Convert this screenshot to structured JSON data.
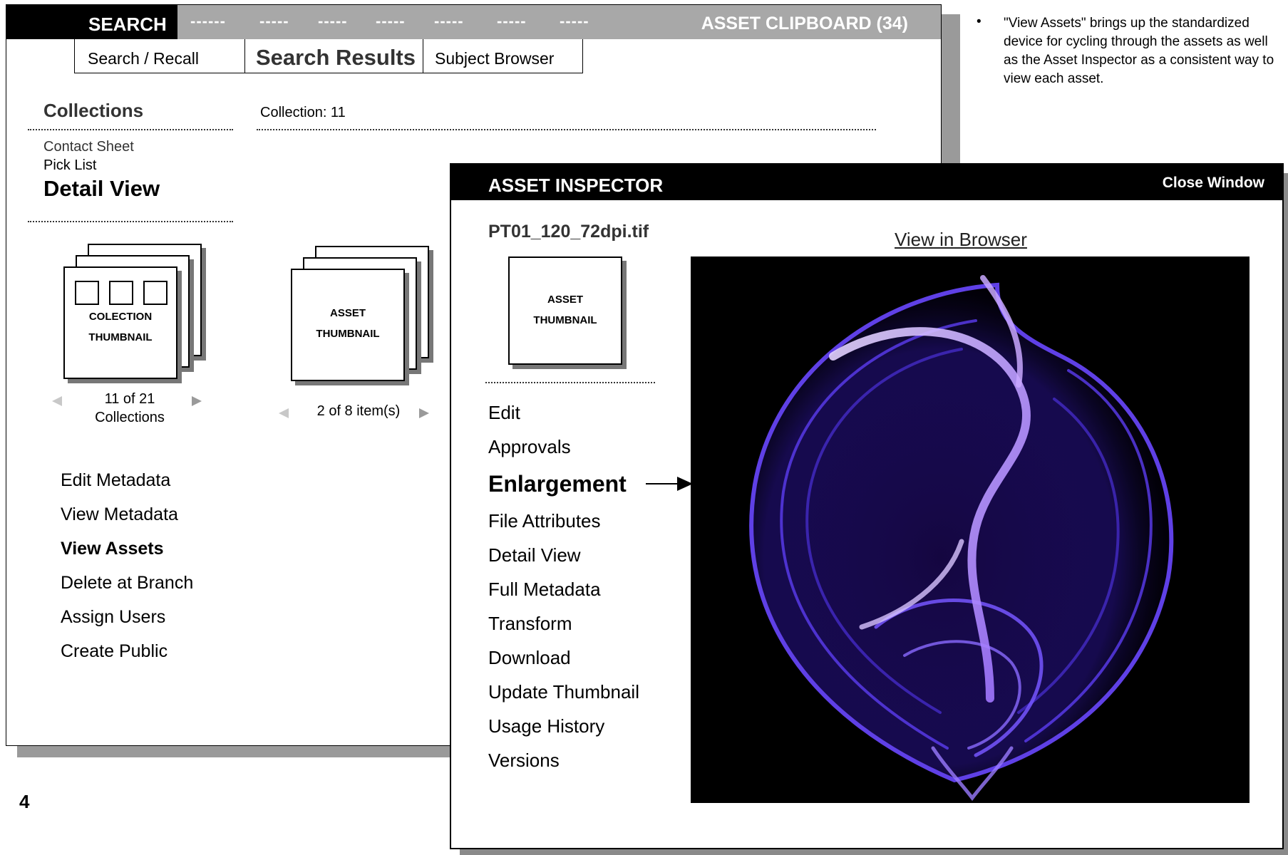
{
  "main": {
    "search_tab": "SEARCH",
    "dashes": [
      "------",
      "-----",
      "-----",
      "-----",
      "-----",
      "-----",
      "-----"
    ],
    "clipboard_label": "ASSET CLIPBOARD (34)",
    "tabs": [
      "Search / Recall",
      "Search Results",
      "Subject Browser"
    ],
    "collections_title": "Collections",
    "collection_label": "Collection: 11",
    "views": [
      "Contact Sheet",
      "Pick List",
      "Detail View"
    ],
    "collection_thumb": [
      "COLECTION",
      "THUMBNAIL"
    ],
    "asset_thumb": [
      "ASSET",
      "THUMBNAIL"
    ],
    "collection_pager": [
      "11 of  21",
      "Collections"
    ],
    "asset_pager": "2 of  8 item(s)",
    "actions": [
      "Edit Metadata",
      "View Metadata",
      "View Assets",
      "Delete at Branch",
      "Assign Users",
      "Create Public"
    ]
  },
  "page_number": "4",
  "note": "\"View Assets\" brings up the standardized device for cycling through the assets as well as the Asset Inspector as a consistent way to view each asset.",
  "inspector": {
    "title": "ASSET INSPECTOR",
    "close_label": "Close Window",
    "file_name": "PT01_120_72dpi.tif",
    "view_in_browser": "View in  Browser",
    "thumb": [
      "ASSET",
      "THUMBNAIL"
    ],
    "menu": [
      "Edit",
      "Approvals",
      "Enlargement",
      "File Attributes",
      "Detail View",
      "Full Metadata",
      "Transform",
      "Download",
      "Update Thumbnail",
      "Usage History",
      "Versions"
    ]
  },
  "colors": {
    "topbar_grey": "#a8a8a8",
    "shell_violet": "#7a55ff",
    "shell_glow": "#c9a8ff"
  }
}
